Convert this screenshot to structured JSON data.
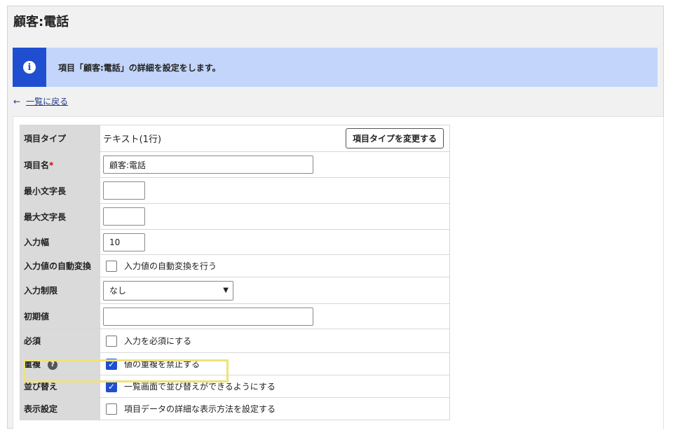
{
  "page": {
    "title": "顧客:電話"
  },
  "info": {
    "message": "項目「顧客:電話」の詳細を設定をします。",
    "icon": "info-icon"
  },
  "back": {
    "label": "一覧に戻る",
    "icon": "arrow-left-icon"
  },
  "form": {
    "item_type": {
      "label": "項目タイプ",
      "value": "テキスト(1行)",
      "button": "項目タイプを変更する"
    },
    "item_name": {
      "label": "項目名",
      "required_mark": "*",
      "value": "顧客:電話"
    },
    "min_length": {
      "label": "最小文字長",
      "value": ""
    },
    "max_length": {
      "label": "最大文字長",
      "value": ""
    },
    "input_width": {
      "label": "入力幅",
      "value": "10"
    },
    "auto_convert": {
      "label": "入力値の自動変換",
      "checkbox_label": "入力値の自動変換を行う",
      "checked": false
    },
    "input_restriction": {
      "label": "入力制限",
      "selected": "なし"
    },
    "default_value": {
      "label": "初期値",
      "value": ""
    },
    "required": {
      "label": "必須",
      "checkbox_label": "入力を必須にする",
      "checked": false
    },
    "duplicate": {
      "label": "重複",
      "help": "?",
      "checkbox_label": "値の重複を禁止する",
      "checked": true
    },
    "sort": {
      "label": "並び替え",
      "checkbox_label": "一覧画面で並び替えができるようにする",
      "checked": true
    },
    "display": {
      "label": "表示設定",
      "checkbox_label": "項目データの詳細な表示方法を設定する",
      "checked": false
    }
  },
  "colors": {
    "accent": "#1f4fd0",
    "info_bg": "#c3d5fb",
    "highlight": "#efe27a"
  }
}
